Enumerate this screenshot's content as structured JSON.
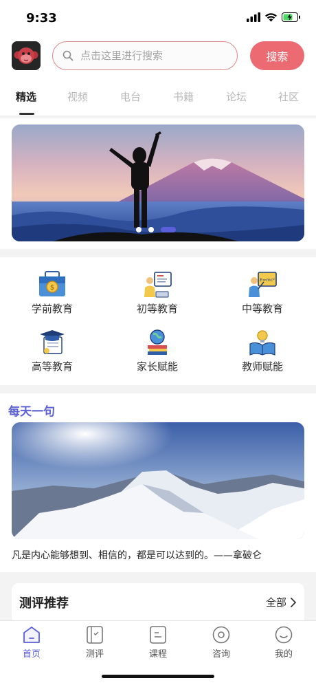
{
  "status_bar": {
    "time": "9:33"
  },
  "header": {
    "search_placeholder": "点击这里进行搜索",
    "search_button": "搜索"
  },
  "tabs": [
    {
      "label": "精选",
      "active": true
    },
    {
      "label": "视频"
    },
    {
      "label": "电台"
    },
    {
      "label": "书籍"
    },
    {
      "label": "论坛"
    },
    {
      "label": "社区"
    }
  ],
  "banner": {
    "slide_count": 3,
    "active_slide": 3
  },
  "categories": [
    {
      "label": "学前教育",
      "icon": "briefcase-money-icon"
    },
    {
      "label": "初等教育",
      "icon": "teacher-board-icon"
    },
    {
      "label": "中等教育",
      "icon": "formula-board-icon"
    },
    {
      "label": "高等教育",
      "icon": "graduation-cap-icon"
    },
    {
      "label": "家长赋能",
      "icon": "globe-books-icon"
    },
    {
      "label": "教师赋能",
      "icon": "open-book-bulb-icon"
    }
  ],
  "daily": {
    "title": "每天一句",
    "quote": "凡是内心能够想到、相信的，都是可以达到的。——拿破仑"
  },
  "recommend": {
    "title": "测评推荐",
    "all_label": "全部"
  },
  "bottom_nav": [
    {
      "label": "首页",
      "icon": "home-icon",
      "active": true
    },
    {
      "label": "测评",
      "icon": "evaluation-icon"
    },
    {
      "label": "课程",
      "icon": "course-icon"
    },
    {
      "label": "咨询",
      "icon": "consult-icon"
    },
    {
      "label": "我的",
      "icon": "profile-icon"
    }
  ],
  "colors": {
    "accent": "#5b5fd9",
    "search_button": "#ec6b73",
    "search_border": "#d98989",
    "daily_title": "#5d61d6"
  }
}
